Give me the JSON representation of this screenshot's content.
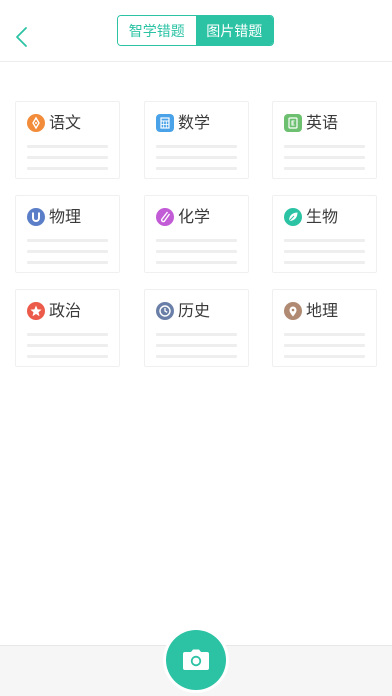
{
  "header": {
    "back_icon": "chevron-left-icon",
    "tabs": [
      {
        "label": "智学错题",
        "active": false
      },
      {
        "label": "图片错题",
        "active": true
      }
    ]
  },
  "subjects": [
    {
      "label": "语文",
      "icon": "pen-nib-icon",
      "color": "#f28c3a"
    },
    {
      "label": "数学",
      "icon": "calculator-icon",
      "color": "#4aa3e8"
    },
    {
      "label": "英语",
      "icon": "english-book-icon",
      "color": "#6cc070"
    },
    {
      "label": "物理",
      "icon": "magnet-icon",
      "color": "#5b7ec9"
    },
    {
      "label": "化学",
      "icon": "test-tube-icon",
      "color": "#c25bd6"
    },
    {
      "label": "生物",
      "icon": "leaf-icon",
      "color": "#2cc3a5"
    },
    {
      "label": "政治",
      "icon": "star-icon",
      "color": "#ec5a4a"
    },
    {
      "label": "历史",
      "icon": "clock-icon",
      "color": "#6a7fa8"
    },
    {
      "label": "地理",
      "icon": "location-pin-icon",
      "color": "#b08a72"
    }
  ],
  "bottom": {
    "camera_icon": "camera-icon",
    "accent": "#2cc3a5"
  },
  "colors": {
    "accent": "#2cc3a5"
  }
}
